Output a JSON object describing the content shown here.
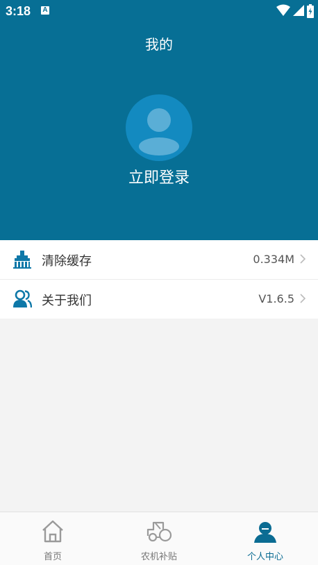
{
  "status_bar": {
    "time": "3:18",
    "notification_badge": "A"
  },
  "header": {
    "title": "我的",
    "login_label": "立即登录"
  },
  "settings": {
    "items": [
      {
        "label": "清除缓存",
        "value": "0.334M",
        "icon": "broom-icon"
      },
      {
        "label": "关于我们",
        "value": "V1.6.5",
        "icon": "users-icon"
      }
    ]
  },
  "bottom_nav": {
    "items": [
      {
        "label": "首页",
        "icon": "home-icon",
        "active": false
      },
      {
        "label": "农机补贴",
        "icon": "tractor-icon",
        "active": false
      },
      {
        "label": "个人中心",
        "icon": "person-icon",
        "active": true
      }
    ]
  },
  "colors": {
    "header_bg": "#076f95",
    "avatar_bg": "#138ac0",
    "accent": "#0b6c93"
  }
}
